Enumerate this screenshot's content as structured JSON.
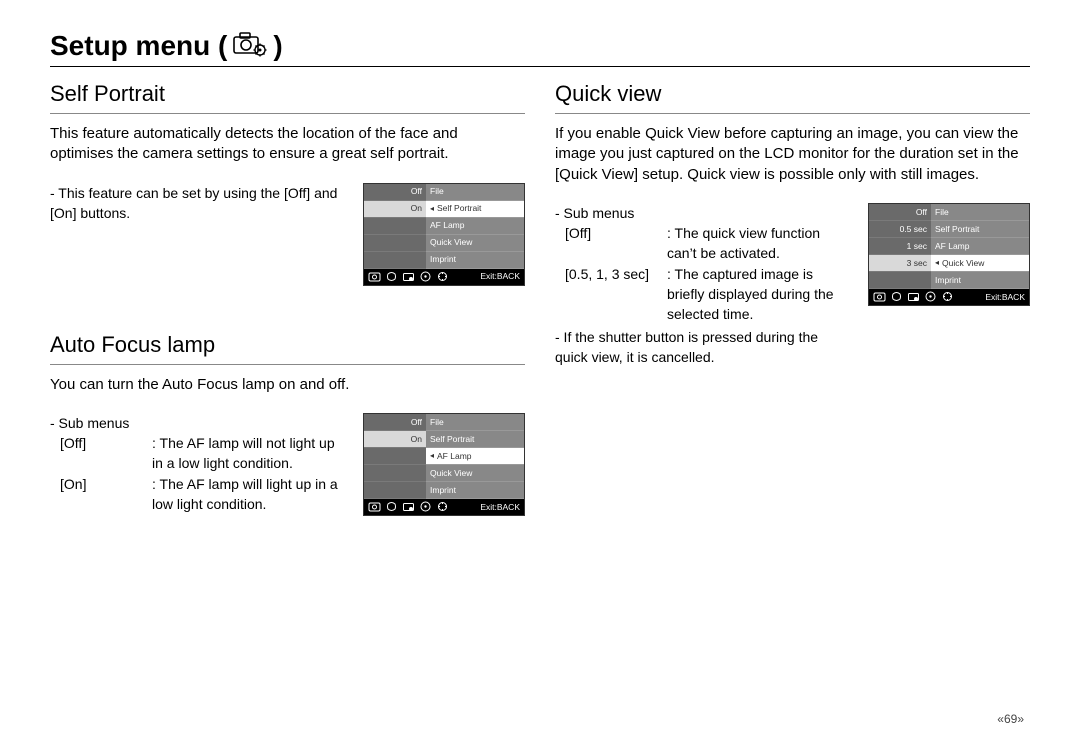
{
  "title": {
    "label": "Setup menu (",
    "end": " )"
  },
  "page_number": "«69»",
  "left": {
    "self_portrait": {
      "heading": "Self Portrait",
      "desc": "This feature automatically detects the location of the face and optimises the camera settings to ensure a great self portrait.",
      "note": "- This feature can be set by using the [Off] and [On] buttons.",
      "screen": {
        "left_opts": [
          "Off",
          "On",
          "",
          "",
          ""
        ],
        "right_opts": [
          "File",
          "Self Portrait",
          "AF Lamp",
          "Quick View",
          "Imprint"
        ],
        "sel_left_index": 1,
        "sel_right_index": 1,
        "exit": "Exit:BACK"
      }
    },
    "af_lamp": {
      "heading": "Auto Focus lamp",
      "desc": "You can turn the Auto Focus lamp on and off.",
      "submenu_label": "- Sub menus",
      "rows": [
        {
          "k": "[Off]",
          "v": ": The AF lamp will not light up in a low light condition."
        },
        {
          "k": "[On]",
          "v": ": The AF lamp will light up in a low light condition."
        }
      ],
      "screen": {
        "left_opts": [
          "Off",
          "On",
          "",
          "",
          ""
        ],
        "right_opts": [
          "File",
          "Self Portrait",
          "AF Lamp",
          "Quick View",
          "Imprint"
        ],
        "sel_left_index": 1,
        "sel_right_index": 2,
        "exit": "Exit:BACK"
      }
    }
  },
  "right": {
    "quick_view": {
      "heading": "Quick view",
      "desc": "If you enable Quick View before capturing an image, you can view the image you just captured on the LCD monitor for the duration set in the [Quick View] setup. Quick view is possible only with still images.",
      "submenu_label": "- Sub menus",
      "rows": [
        {
          "k": "[Off]",
          "v": ": The quick view function can’t be activated."
        },
        {
          "k": "[0.5, 1, 3 sec]",
          "v": ": The captured image is briefly displayed during the selected time."
        }
      ],
      "note": "- If the shutter button is pressed during the quick view, it is cancelled.",
      "screen": {
        "left_opts": [
          "Off",
          "0.5 sec",
          "1 sec",
          "3 sec",
          ""
        ],
        "right_opts": [
          "File",
          "Self Portrait",
          "AF Lamp",
          "Quick View",
          "Imprint"
        ],
        "sel_left_index": 3,
        "sel_right_index": 3,
        "exit": "Exit:BACK"
      }
    }
  }
}
